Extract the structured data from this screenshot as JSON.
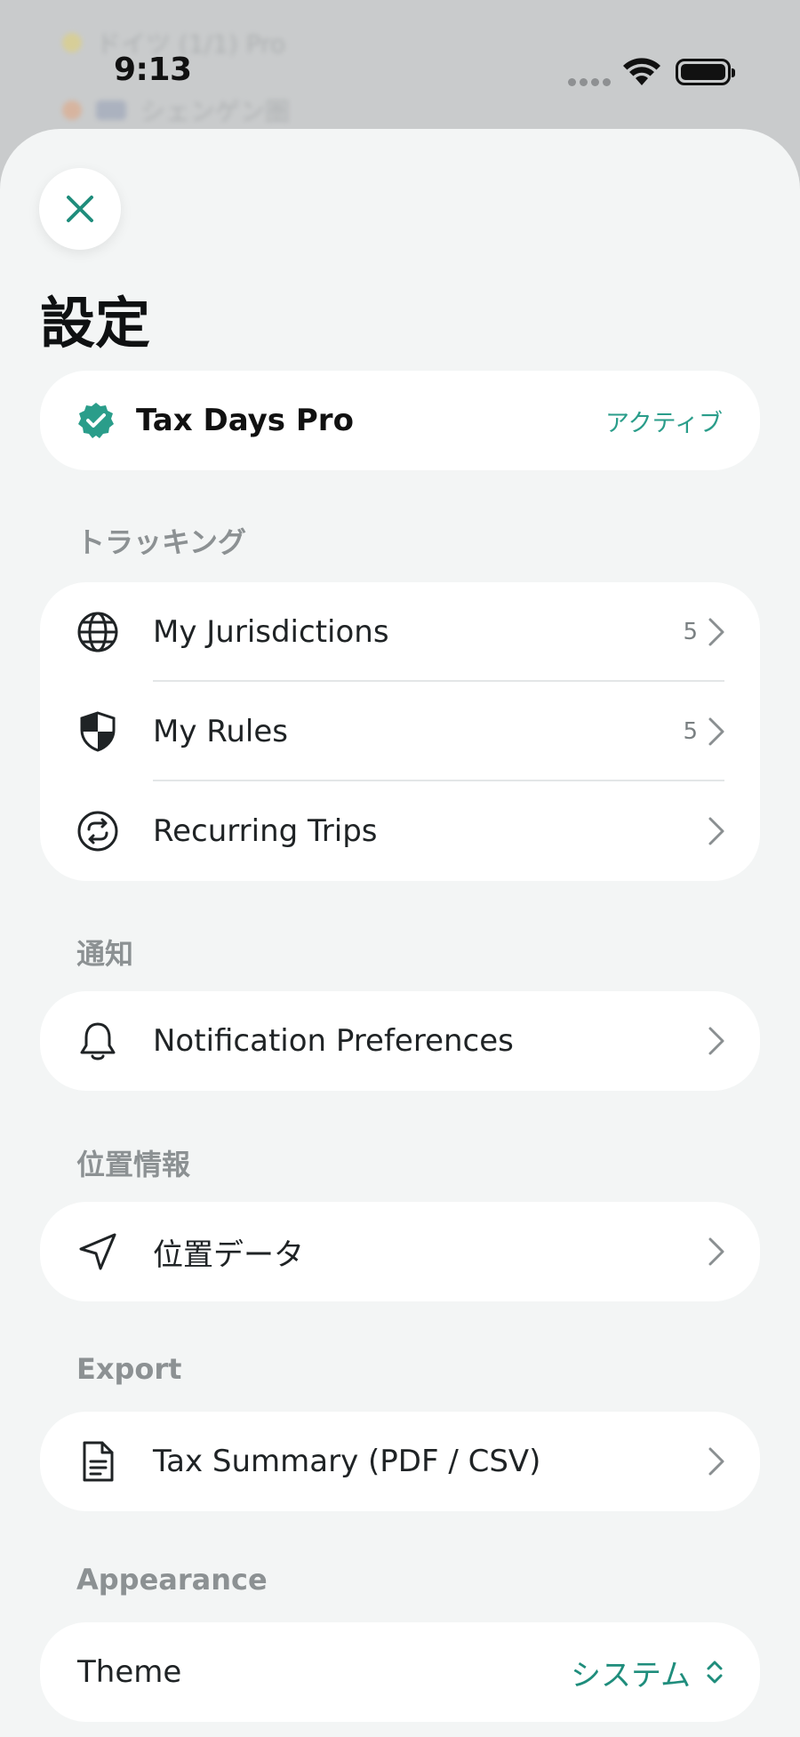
{
  "status_bar": {
    "time": "9:13"
  },
  "background_list": [
    {
      "text": "ドイツ (1/1) Pro",
      "value": "",
      "dot_color": "#e8d25a"
    },
    {
      "text": "シェンゲン圏",
      "value": "",
      "dot_color": "#e89a6a"
    }
  ],
  "header": {
    "title": "設定"
  },
  "subscription": {
    "name": "Tax Days Pro",
    "status": "アクティブ"
  },
  "sections": {
    "tracking": {
      "title": "トラッキング",
      "items": [
        {
          "label": "My Jurisdictions",
          "count": "5",
          "icon": "globe-icon"
        },
        {
          "label": "My Rules",
          "count": "5",
          "icon": "shield-icon"
        },
        {
          "label": "Recurring Trips",
          "count": "",
          "icon": "repeat-icon"
        }
      ]
    },
    "notifications": {
      "title": "通知",
      "items": [
        {
          "label": "Notification Preferences",
          "icon": "bell-icon"
        }
      ]
    },
    "location": {
      "title": "位置情報",
      "items": [
        {
          "label": "位置データ",
          "icon": "location-arrow-icon"
        }
      ]
    },
    "export": {
      "title": "Export",
      "items": [
        {
          "label": "Tax Summary (PDF / CSV)",
          "icon": "document-icon"
        }
      ]
    },
    "appearance": {
      "title": "Appearance",
      "theme_label": "Theme",
      "theme_value": "システム"
    }
  },
  "colors": {
    "accent": "#2a9d8a",
    "sheet_bg": "#f3f5f5",
    "card_bg": "#ffffff"
  }
}
